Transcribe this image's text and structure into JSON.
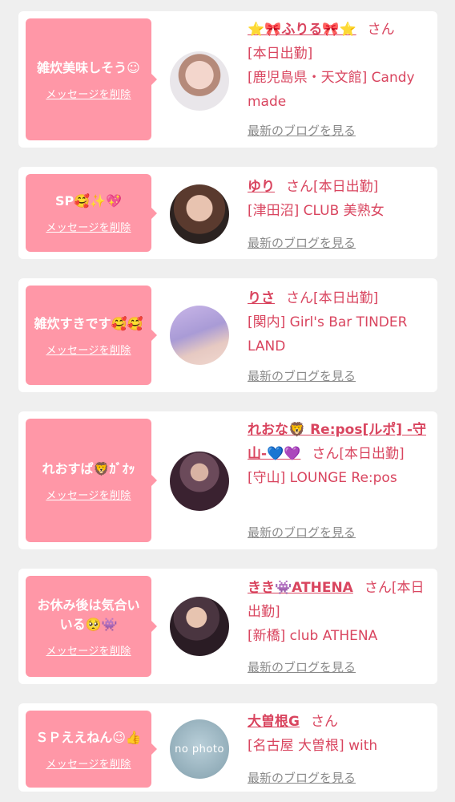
{
  "delete_label": "メッセージを削除",
  "blog_label": "最新のブログを見る",
  "san_label": "さん",
  "entries": [
    {
      "message": "雑炊美味しそう☺",
      "name": "⭐🎀ふりる🎀⭐",
      "status": "[本日出勤]",
      "shop": "[鹿児島県・天文館] Candy made"
    },
    {
      "message": "SP🥰✨💖",
      "name": "ゆり",
      "status": "[本日出勤]",
      "shop": "[津田沼] CLUB 美熟女"
    },
    {
      "message": "雑炊すきです🥰🥰",
      "name": "りさ",
      "status": "[本日出勤]",
      "shop": "[関内] Girl's Bar TINDER LAND"
    },
    {
      "message": "れおすぱ🦁ｶﾞｵｯ",
      "name": "れおな🦁 Re:pos[ルポ] -守山-💙💜",
      "status": "[本日出勤]",
      "shop": "[守山] LOUNGE Re:pos"
    },
    {
      "message": "お休み後は気合いいる🥺👾",
      "name": "きき👾ATHENA",
      "status": "[本日出勤]",
      "shop": "[新橋] club ATHENA"
    },
    {
      "message": "ＳＰええねん😉👍",
      "name": "大曽根G",
      "status": "",
      "shop": "[名古屋 大曽根] with",
      "avatar_text": "no photo"
    }
  ]
}
